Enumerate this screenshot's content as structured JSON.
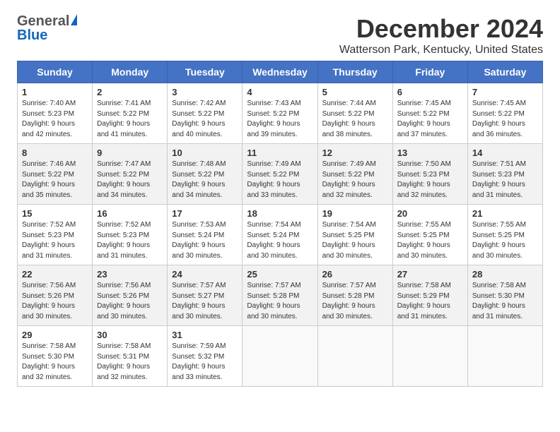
{
  "logo": {
    "general": "General",
    "blue": "Blue"
  },
  "title": "December 2024",
  "subtitle": "Watterson Park, Kentucky, United States",
  "days_of_week": [
    "Sunday",
    "Monday",
    "Tuesday",
    "Wednesday",
    "Thursday",
    "Friday",
    "Saturday"
  ],
  "weeks": [
    [
      {
        "day": "1",
        "sunrise": "7:40 AM",
        "sunset": "5:23 PM",
        "daylight": "9 hours and 42 minutes."
      },
      {
        "day": "2",
        "sunrise": "7:41 AM",
        "sunset": "5:22 PM",
        "daylight": "9 hours and 41 minutes."
      },
      {
        "day": "3",
        "sunrise": "7:42 AM",
        "sunset": "5:22 PM",
        "daylight": "9 hours and 40 minutes."
      },
      {
        "day": "4",
        "sunrise": "7:43 AM",
        "sunset": "5:22 PM",
        "daylight": "9 hours and 39 minutes."
      },
      {
        "day": "5",
        "sunrise": "7:44 AM",
        "sunset": "5:22 PM",
        "daylight": "9 hours and 38 minutes."
      },
      {
        "day": "6",
        "sunrise": "7:45 AM",
        "sunset": "5:22 PM",
        "daylight": "9 hours and 37 minutes."
      },
      {
        "day": "7",
        "sunrise": "7:45 AM",
        "sunset": "5:22 PM",
        "daylight": "9 hours and 36 minutes."
      }
    ],
    [
      {
        "day": "8",
        "sunrise": "7:46 AM",
        "sunset": "5:22 PM",
        "daylight": "9 hours and 35 minutes."
      },
      {
        "day": "9",
        "sunrise": "7:47 AM",
        "sunset": "5:22 PM",
        "daylight": "9 hours and 34 minutes."
      },
      {
        "day": "10",
        "sunrise": "7:48 AM",
        "sunset": "5:22 PM",
        "daylight": "9 hours and 34 minutes."
      },
      {
        "day": "11",
        "sunrise": "7:49 AM",
        "sunset": "5:22 PM",
        "daylight": "9 hours and 33 minutes."
      },
      {
        "day": "12",
        "sunrise": "7:49 AM",
        "sunset": "5:22 PM",
        "daylight": "9 hours and 32 minutes."
      },
      {
        "day": "13",
        "sunrise": "7:50 AM",
        "sunset": "5:23 PM",
        "daylight": "9 hours and 32 minutes."
      },
      {
        "day": "14",
        "sunrise": "7:51 AM",
        "sunset": "5:23 PM",
        "daylight": "9 hours and 31 minutes."
      }
    ],
    [
      {
        "day": "15",
        "sunrise": "7:52 AM",
        "sunset": "5:23 PM",
        "daylight": "9 hours and 31 minutes."
      },
      {
        "day": "16",
        "sunrise": "7:52 AM",
        "sunset": "5:23 PM",
        "daylight": "9 hours and 31 minutes."
      },
      {
        "day": "17",
        "sunrise": "7:53 AM",
        "sunset": "5:24 PM",
        "daylight": "9 hours and 30 minutes."
      },
      {
        "day": "18",
        "sunrise": "7:54 AM",
        "sunset": "5:24 PM",
        "daylight": "9 hours and 30 minutes."
      },
      {
        "day": "19",
        "sunrise": "7:54 AM",
        "sunset": "5:25 PM",
        "daylight": "9 hours and 30 minutes."
      },
      {
        "day": "20",
        "sunrise": "7:55 AM",
        "sunset": "5:25 PM",
        "daylight": "9 hours and 30 minutes."
      },
      {
        "day": "21",
        "sunrise": "7:55 AM",
        "sunset": "5:25 PM",
        "daylight": "9 hours and 30 minutes."
      }
    ],
    [
      {
        "day": "22",
        "sunrise": "7:56 AM",
        "sunset": "5:26 PM",
        "daylight": "9 hours and 30 minutes."
      },
      {
        "day": "23",
        "sunrise": "7:56 AM",
        "sunset": "5:26 PM",
        "daylight": "9 hours and 30 minutes."
      },
      {
        "day": "24",
        "sunrise": "7:57 AM",
        "sunset": "5:27 PM",
        "daylight": "9 hours and 30 minutes."
      },
      {
        "day": "25",
        "sunrise": "7:57 AM",
        "sunset": "5:28 PM",
        "daylight": "9 hours and 30 minutes."
      },
      {
        "day": "26",
        "sunrise": "7:57 AM",
        "sunset": "5:28 PM",
        "daylight": "9 hours and 30 minutes."
      },
      {
        "day": "27",
        "sunrise": "7:58 AM",
        "sunset": "5:29 PM",
        "daylight": "9 hours and 31 minutes."
      },
      {
        "day": "28",
        "sunrise": "7:58 AM",
        "sunset": "5:30 PM",
        "daylight": "9 hours and 31 minutes."
      }
    ],
    [
      {
        "day": "29",
        "sunrise": "7:58 AM",
        "sunset": "5:30 PM",
        "daylight": "9 hours and 32 minutes."
      },
      {
        "day": "30",
        "sunrise": "7:58 AM",
        "sunset": "5:31 PM",
        "daylight": "9 hours and 32 minutes."
      },
      {
        "day": "31",
        "sunrise": "7:59 AM",
        "sunset": "5:32 PM",
        "daylight": "9 hours and 33 minutes."
      },
      null,
      null,
      null,
      null
    ]
  ],
  "labels": {
    "sunrise": "Sunrise:",
    "sunset": "Sunset:",
    "daylight": "Daylight:"
  }
}
